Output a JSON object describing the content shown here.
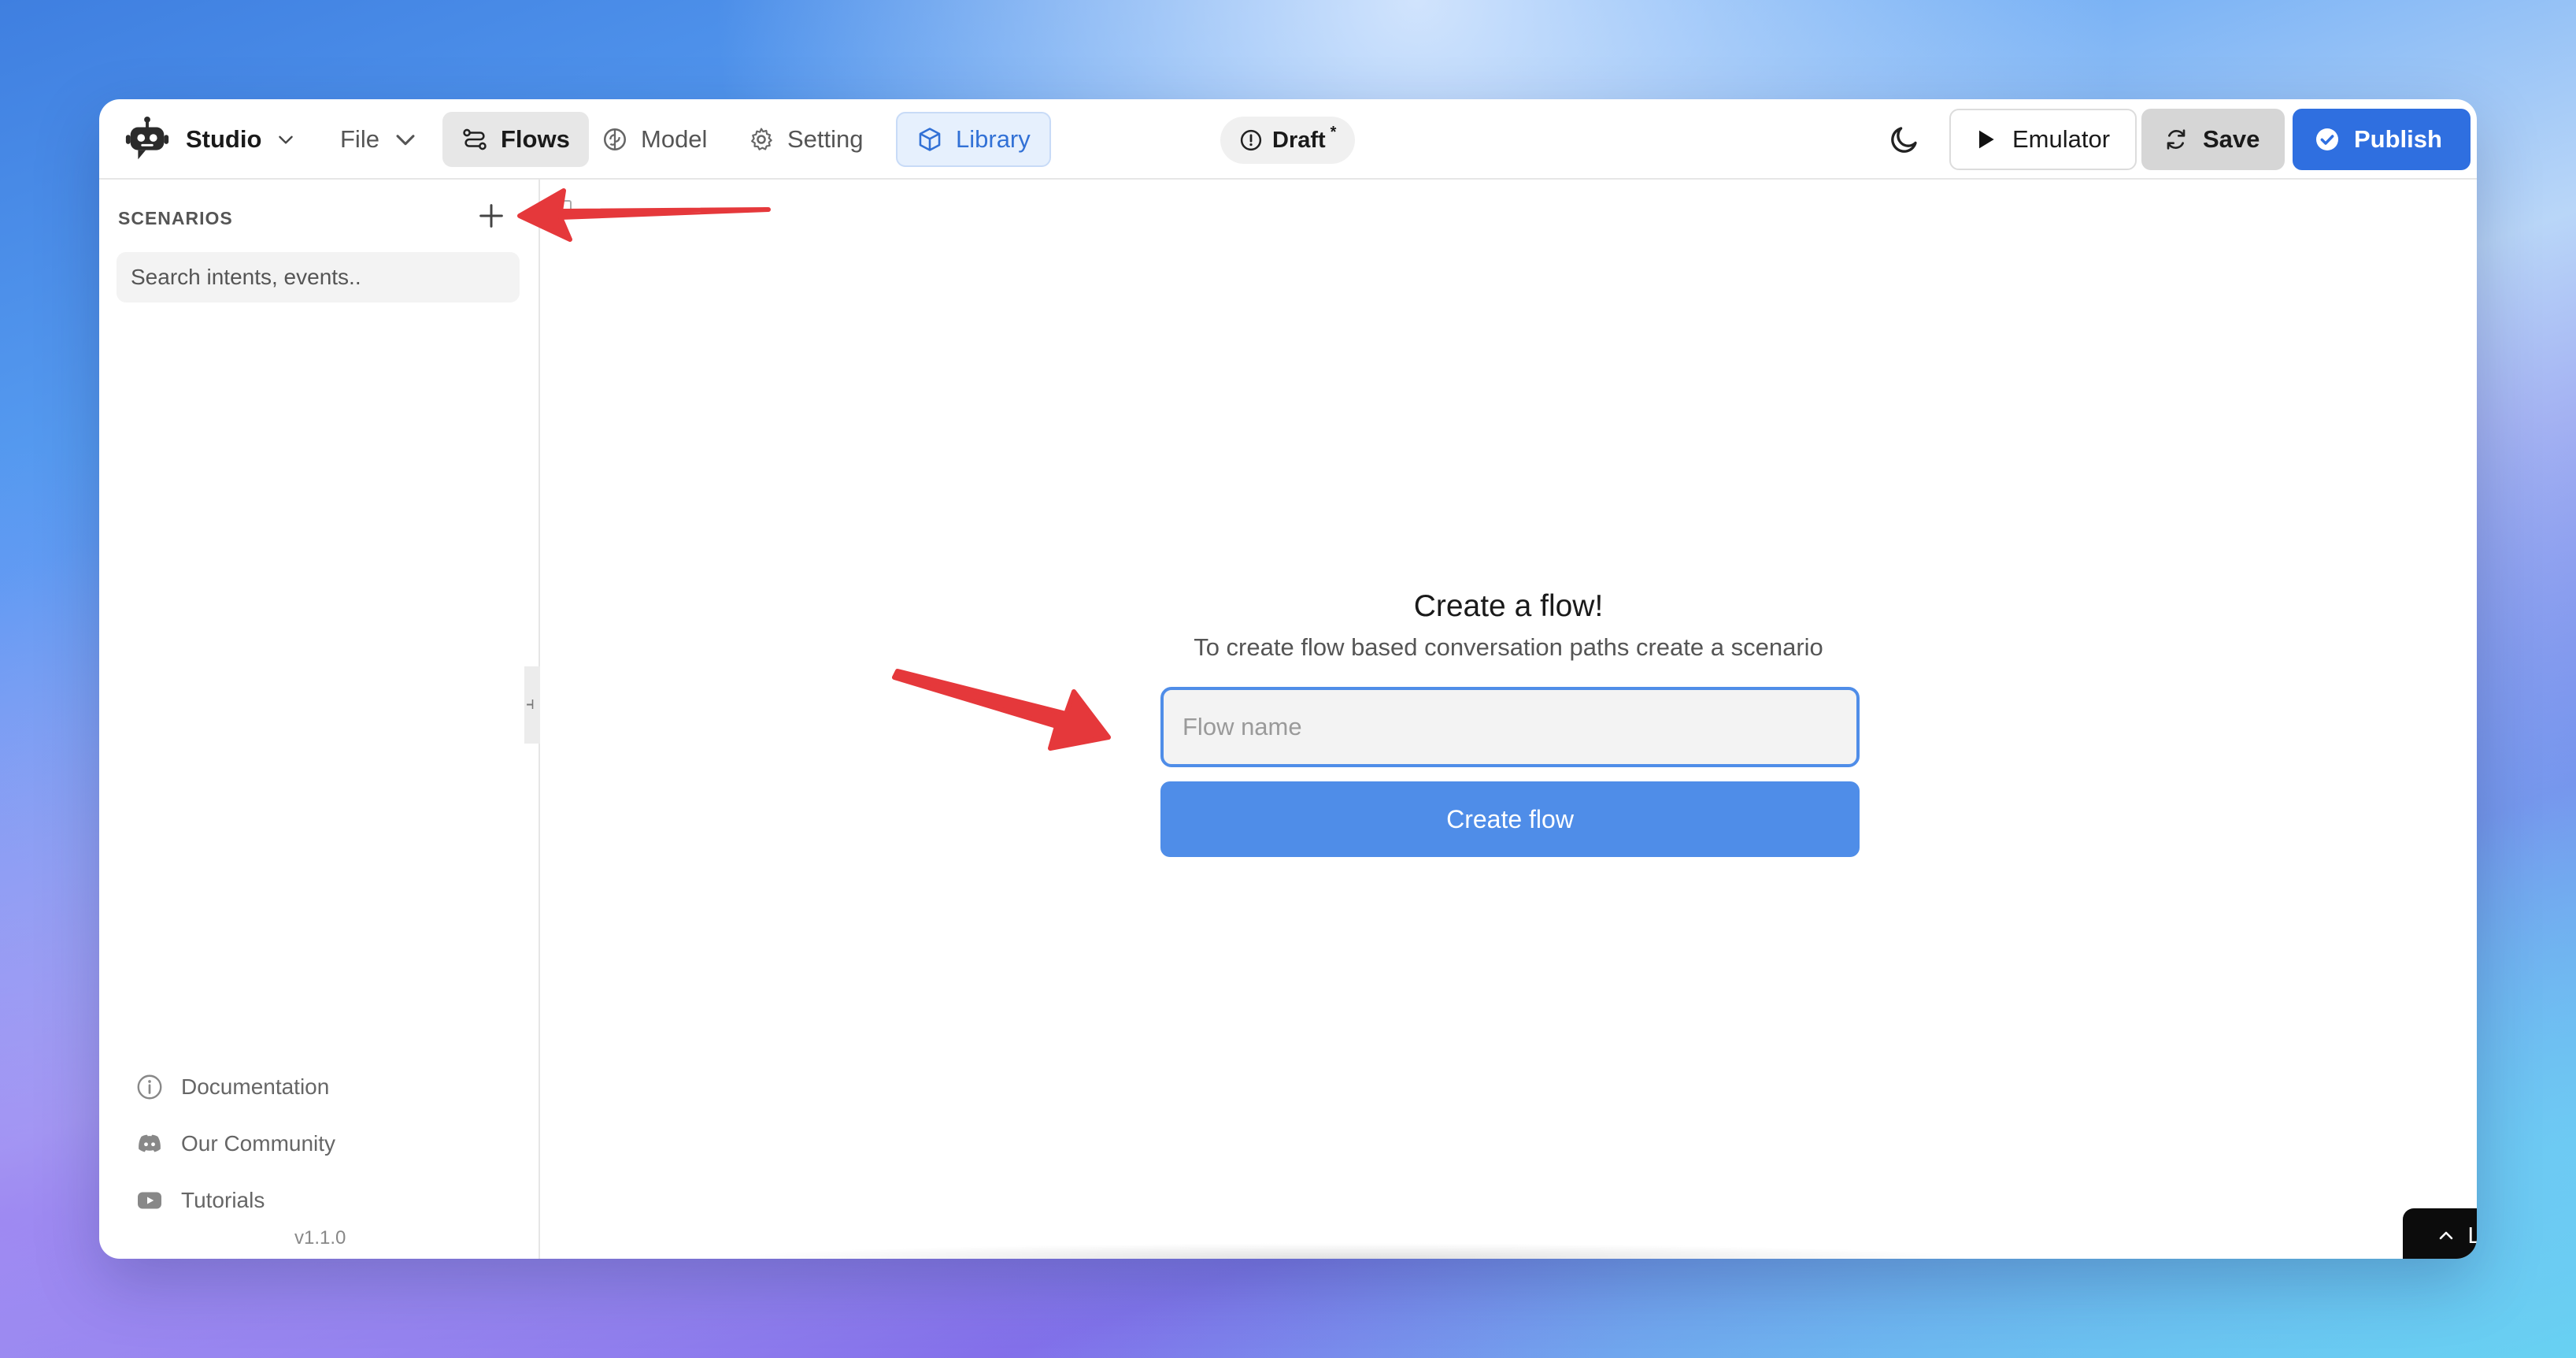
{
  "app": {
    "brand": "Studio",
    "colors": {
      "accent": "#2f6fe0",
      "button_primary": "#4f8de8",
      "library_text": "#3271d6",
      "annotation_arrow": "#e5383b"
    }
  },
  "topbar": {
    "nav": [
      {
        "label": "File",
        "icon": "chevron-down-icon"
      },
      {
        "label": "Flows",
        "icon": "flows-icon",
        "active": true
      },
      {
        "label": "Model",
        "icon": "brain-icon"
      },
      {
        "label": "Setting",
        "icon": "gear-icon"
      },
      {
        "label": "Library",
        "icon": "cube-icon",
        "highlighted": true
      }
    ],
    "draft": {
      "label": "Draft",
      "marker": "*",
      "icon": "info-circle-icon"
    },
    "theme_icon": "moon-icon",
    "emulator_label": "Emulator",
    "save_label": "Save",
    "publish_label": "Publish"
  },
  "sidebar": {
    "title": "SCENARIOS",
    "add_icon": "plus-icon",
    "search": {
      "placeholder": "Search intents, events..",
      "value": ""
    },
    "links": [
      {
        "label": "Documentation",
        "icon": "info-circle-icon"
      },
      {
        "label": "Our Community",
        "icon": "discord-icon"
      },
      {
        "label": "Tutorials",
        "icon": "youtube-icon"
      }
    ],
    "version": "v1.1.0"
  },
  "main": {
    "title": "Create a flow!",
    "subtitle": "To create flow based conversation paths create a scenario",
    "input": {
      "placeholder": "Flow name",
      "value": ""
    },
    "create_label": "Create flow"
  },
  "logs": {
    "label": "Logs",
    "icon": "chevron-up-icon"
  }
}
